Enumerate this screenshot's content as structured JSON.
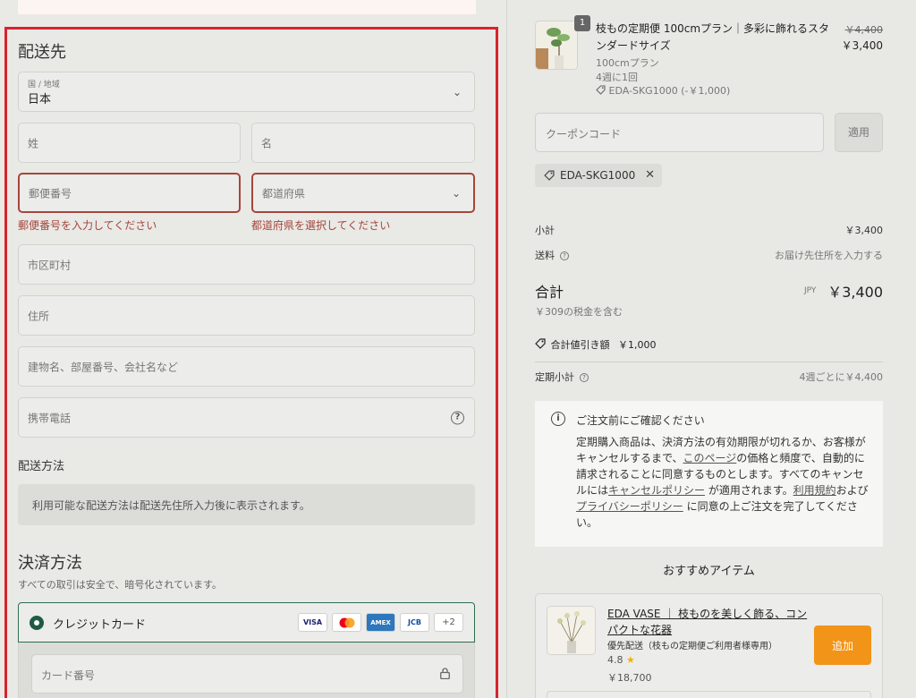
{
  "shipping": {
    "title": "配送先",
    "country": {
      "label": "国 / 地域",
      "value": "日本"
    },
    "last_name_placeholder": "姓",
    "first_name_placeholder": "名",
    "postal_placeholder": "郵便番号",
    "prefecture_placeholder": "都道府県",
    "postal_error": "郵便番号を入力してください",
    "prefecture_error": "都道府県を選択してください",
    "city_placeholder": "市区町村",
    "address_placeholder": "住所",
    "building_placeholder": "建物名、部屋番号、会社名など",
    "phone_placeholder": "携帯電話"
  },
  "delivery": {
    "title": "配送方法",
    "notice": "利用可能な配送方法は配送先住所入力後に表示されます。"
  },
  "payment": {
    "title": "決済方法",
    "subtitle": "すべての取引は安全で、暗号化されています。",
    "credit_label": "クレジットカード",
    "card_logos": [
      "VISA",
      "●●",
      "AMEX",
      "JCB",
      "+2"
    ],
    "card_number_placeholder": "カード番号"
  },
  "cart": {
    "item": {
      "quantity": "1",
      "name": "枝もの定期便 100cmプラン｜多彩に飾れるスタンダードサイズ",
      "plan": "100cmプラン",
      "frequency": "4週に1回",
      "discount_tag": "EDA-SKG1000 (-￥1,000)",
      "price_old": "￥4,400",
      "price_new": "￥3,400"
    },
    "coupon_placeholder": "クーポンコード",
    "apply_label": "適用",
    "applied_code": "EDA-SKG1000"
  },
  "summary": {
    "subtotal_label": "小計",
    "subtotal_value": "￥3,400",
    "shipping_label": "送料",
    "shipping_value": "お届け先住所を入力する",
    "total_label": "合計",
    "total_currency": "JPY",
    "total_value": "￥3,400",
    "tax_note": "￥309の税金を含む",
    "discount_label": "合計値引き額",
    "discount_value": "￥1,000",
    "recurring_label": "定期小計",
    "recurring_value": "4週ごとに￥4,400"
  },
  "confirm": {
    "title": "ご注文前にご確認ください",
    "body_1": "定期購入商品は、決済方法の有効期限が切れるか、お客様がキャンセルするまで、",
    "link_page": "このページ",
    "body_2": "の価格と頻度で、自動的に請求されることに同意するものとします。すべてのキャンセルには",
    "link_cancel": "キャンセルポリシー",
    "body_3": " が適用されます。",
    "link_terms": "利用規約",
    "body_4": "および",
    "link_privacy": "プライバシーポリシー",
    "body_5": " に同意の上ご注文を完了してください。"
  },
  "recommend": {
    "title": "おすすめアイテム",
    "name": "EDA VASE ｜ 枝ものを美しく飾る、コンパクトな花器",
    "shipping": "優先配送（枝もの定期便ご利用者様専用）",
    "rating": "4.8",
    "price": "￥18,700",
    "add_label": "追加"
  },
  "colors": {
    "accent": "#1f5b44",
    "error": "#a5463b",
    "add_button": "#f29417",
    "highlight_frame": "#d9232d"
  }
}
